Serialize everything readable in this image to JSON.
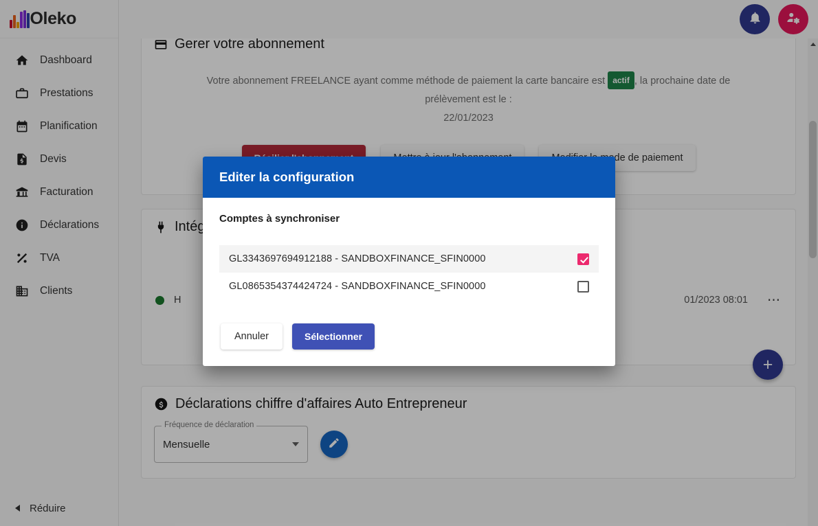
{
  "app": {
    "logo_text": "Oleko"
  },
  "sidebar": {
    "items": [
      {
        "label": "Dashboard",
        "icon": "home-icon"
      },
      {
        "label": "Prestations",
        "icon": "briefcase-icon"
      },
      {
        "label": "Planification",
        "icon": "calendar-icon"
      },
      {
        "label": "Devis",
        "icon": "quote-document-icon"
      },
      {
        "label": "Facturation",
        "icon": "bank-icon"
      },
      {
        "label": "Déclarations",
        "icon": "info-icon"
      },
      {
        "label": "TVA",
        "icon": "percent-icon"
      },
      {
        "label": "Clients",
        "icon": "building-icon"
      }
    ],
    "collapse_label": "Réduire"
  },
  "topbar": {
    "notifications_icon": "bell-icon",
    "account_icon": "user-settings-icon"
  },
  "subscription_card": {
    "title": "Gerer votre abonnement",
    "icon": "credit-card-icon",
    "text_part1": "Votre abonnement FREELANCE ayant comme méthode de paiement la carte bancaire est",
    "status_badge": "actif",
    "text_part2": ", la prochaine date de prélèvement est le :",
    "next_date": "22/01/2023",
    "buttons": [
      {
        "label": "Résilier l'abonnement",
        "style": "danger"
      },
      {
        "label": "Mettre à jour l'abonnement",
        "style": "plain"
      },
      {
        "label": "Modifier le mode de paiement",
        "style": "plain"
      }
    ]
  },
  "integrations_card": {
    "title": "Intégrations",
    "icon": "plug-icon",
    "row": {
      "status_dot": "green",
      "name": "H",
      "date": "01/2023 08:01",
      "menu_icon": "kebab-menu-icon"
    },
    "fab_label": "+"
  },
  "declarations_card": {
    "title": "Déclarations chiffre d'affaires Auto Entrepreneur",
    "icon": "dollar-circle-icon",
    "field_legend": "Fréquence de déclaration",
    "field_value": "Mensuelle",
    "edit_icon": "pencil-icon"
  },
  "modal": {
    "title": "Editer la configuration",
    "subtitle": "Comptes à synchroniser",
    "accounts": [
      {
        "label": "GL3343697694912188 - SANDBOXFINANCE_SFIN0000",
        "checked": true
      },
      {
        "label": "GL0865354374424724 - SANDBOXFINANCE_SFIN0000",
        "checked": false
      }
    ],
    "cancel_label": "Annuler",
    "confirm_label": "Sélectionner"
  },
  "colors": {
    "modal_header": "#0b57b5",
    "primary": "#3f51b5",
    "danger": "#b32a3a",
    "checkbox_on": "#ec2a6e",
    "status_green": "#1e8449",
    "account_btn": "#e5175a",
    "bell_btn": "#30398f"
  }
}
